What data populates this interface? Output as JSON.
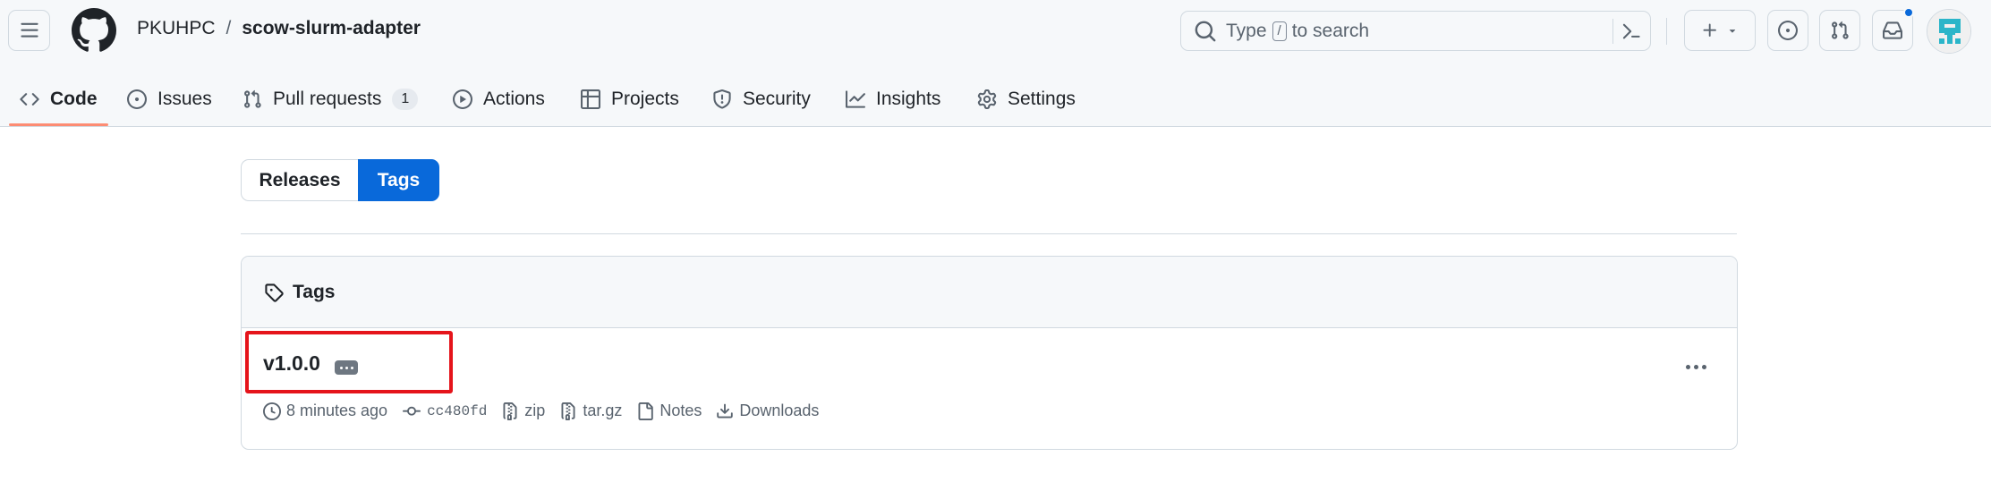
{
  "header": {
    "owner": "PKUHPC",
    "separator": "/",
    "repo": "scow-slurm-adapter",
    "search": {
      "prefix": "Type",
      "key": "/",
      "suffix": "to search"
    }
  },
  "nav": {
    "code": "Code",
    "issues": "Issues",
    "pull_requests": "Pull requests",
    "pull_requests_count": "1",
    "actions": "Actions",
    "projects": "Projects",
    "security": "Security",
    "insights": "Insights",
    "settings": "Settings"
  },
  "segmented": {
    "releases": "Releases",
    "tags": "Tags",
    "selected": "Tags"
  },
  "tags_box": {
    "title": "Tags",
    "tag": {
      "name": "v1.0.0",
      "time": "8 minutes ago",
      "commit": "cc480fd",
      "zip": "zip",
      "tar": "tar.gz",
      "notes": "Notes",
      "downloads": "Downloads"
    }
  },
  "colors": {
    "accent": "#0969da",
    "active_tab_underline": "#fd8c73",
    "highlight_box": "#e5141b",
    "notification_dot": "#0969da"
  },
  "icons": [
    "hamburger-icon",
    "github-logo",
    "search-icon",
    "command-palette-icon",
    "plus-icon",
    "chevron-down-icon",
    "issue-opened-icon",
    "git-pull-request-icon",
    "inbox-icon",
    "code-icon",
    "play-icon",
    "table-icon",
    "shield-icon",
    "graph-icon",
    "gear-icon",
    "tag-icon",
    "clock-icon",
    "git-commit-icon",
    "file-zip-icon",
    "file-icon",
    "download-icon",
    "kebab-horizontal-icon"
  ]
}
